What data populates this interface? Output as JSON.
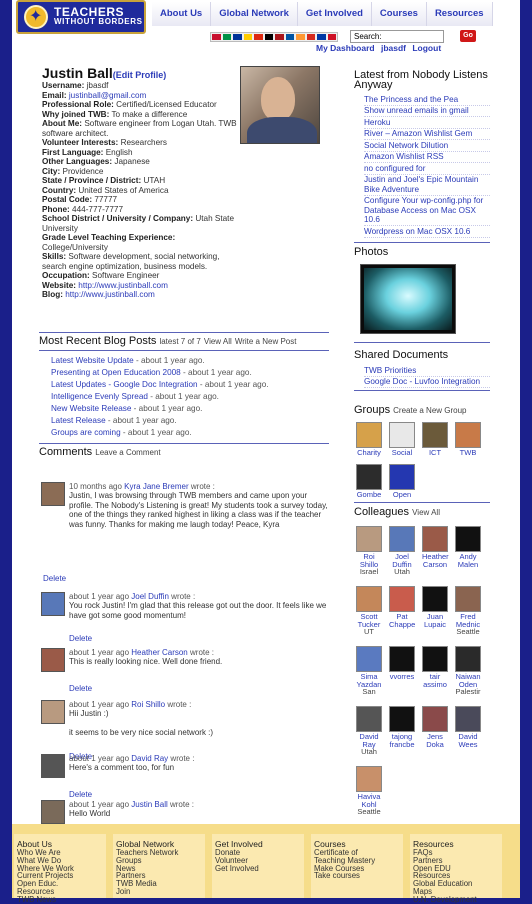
{
  "header": {
    "logo_line1": "TEACHERS",
    "logo_line2": "WITHOUT BORDERS",
    "nav": [
      "About Us",
      "Global Network",
      "Get Involved",
      "Courses",
      "Resources"
    ],
    "search_value": "Search:",
    "go_label": "Go",
    "user_links": [
      "My Dashboard",
      "jbasdf",
      "Logout"
    ],
    "flag_colors": [
      "#c8102e",
      "#009246",
      "#003399",
      "#ffcc00",
      "#de2910",
      "#000000",
      "#aa151b",
      "#0055a4",
      "#ff9933",
      "#d52b1e",
      "#0039a6",
      "#ce1126"
    ]
  },
  "profile": {
    "name": "Justin Ball",
    "edit_label": "(Edit Profile)",
    "fields": [
      {
        "label": "Username:",
        "value": "jbasdf"
      },
      {
        "label": "Email:",
        "value": "justinball@gmail.com",
        "link": true
      },
      {
        "label": "Professional Role:",
        "value": "Certified/Licensed Educator"
      },
      {
        "label": "Why joined TWB:",
        "value": "To make a difference"
      },
      {
        "label": "About Me:",
        "value": "Software engineer from Logan Utah. TWB software architect."
      },
      {
        "label": "Volunteer Interests:",
        "value": "Researchers"
      },
      {
        "label": "First Language:",
        "value": "English"
      },
      {
        "label": "Other Languages:",
        "value": "Japanese"
      },
      {
        "label": "City:",
        "value": "Providence"
      },
      {
        "label": "State / Province / District:",
        "value": "UTAH"
      },
      {
        "label": "Country:",
        "value": "United States of America"
      },
      {
        "label": "Postal Code:",
        "value": "77777"
      },
      {
        "label": "Phone:",
        "value": "444-777-7777"
      },
      {
        "label": "School District / University / Company:",
        "value": "Utah State University"
      },
      {
        "label": "Grade Level Teaching Experience:",
        "value": "College/University"
      },
      {
        "label": "Skills:",
        "value": "Software development, social networking, search engine optimization, business models."
      },
      {
        "label": "Occupation:",
        "value": "Software Engineer"
      },
      {
        "label": "Website:",
        "value": "http://www.justinball.com",
        "link": true
      },
      {
        "label": "Blog:",
        "value": "http://www.justinball.com",
        "link": true
      }
    ]
  },
  "blog": {
    "title": "Most Recent Blog Posts",
    "count_text": "latest 7 of 7",
    "view_all": "View All",
    "write_new": "Write a New Post",
    "posts": [
      {
        "title": "Latest Website Update",
        "age": " - about 1 year ago."
      },
      {
        "title": "Presenting at Open Education 2008",
        "age": " - about 1 year ago."
      },
      {
        "title": "Latest Updates - Google Doc Integration",
        "age": " - about 1 year ago."
      },
      {
        "title": "Intelligence Evenly Spread",
        "age": " - about 1 year ago."
      },
      {
        "title": "New Website Release",
        "age": " - about 1 year ago."
      },
      {
        "title": "Latest Release",
        "age": " - about 1 year ago."
      },
      {
        "title": "Groups are coming",
        "age": " - about 1 year ago."
      }
    ]
  },
  "comments": {
    "title": "Comments",
    "leave": "Leave a Comment",
    "delete_label": "Delete",
    "items": [
      {
        "age": "10 months ago",
        "author": "Kyra Jane Bremer",
        "wrote": "wrote :",
        "text": "Justin, I was browsing through TWB members and came upon your profile. The Nobody's Listening is great! My students took a survey today, one of the things they ranked highest in liking a class was if the teacher was funny. Thanks for making me laugh today! Peace, Kyra",
        "color": "#8b6c55"
      },
      {
        "age": "about 1 year ago",
        "author": "Joel Duffin",
        "wrote": "wrote :",
        "text": "You rock Justin! I'm glad that this release got out the door. It feels like we have got some good momentum!",
        "color": "#5878b8"
      },
      {
        "age": "about 1 year ago",
        "author": "Heather Carson",
        "wrote": "wrote :",
        "text": "This is really looking nice. Well done friend.",
        "color": "#9a5a48"
      },
      {
        "age": "about 1 year ago",
        "author": "Roi Shillo",
        "wrote": "wrote :",
        "text": "Hii Justin :)\n\nit seems to be very nice social network :)",
        "color": "#b89a80"
      },
      {
        "age": "about 1 year ago",
        "author": "David Ray",
        "wrote": "wrote :",
        "text": "Here's a comment too, for fun",
        "color": "#555555"
      },
      {
        "age": "about 1 year ago",
        "author": "Justin Ball",
        "wrote": "wrote :",
        "text": "Hello World",
        "color": "#7a6a5a"
      }
    ]
  },
  "right": {
    "latest_title": "Latest from Nobody Listens Anyway",
    "latest": [
      "The Princess and the Pea",
      "Show unread emails in gmail",
      "Heroku",
      "River – Amazon Wishlist Gem",
      "Social Network Dilution",
      "Amazon Wishlist RSS",
      "no configured for",
      "Justin and Joel's Epic Mountain Bike Adventure",
      "Configure Your wp-config.php for Database Access on Mac OSX 10.6",
      "Wordpress on Mac OSX 10.6"
    ],
    "photos_title": "Photos",
    "docs_title": "Shared Documents",
    "docs": [
      "TWB Priorities",
      "Google Doc - Luvfoo Integration"
    ],
    "groups_title": "Groups",
    "groups_link": "Create a New Group",
    "groups": [
      {
        "name": "Charity",
        "color": "#d6a14a"
      },
      {
        "name": "Social",
        "color": "#e8e8e8"
      },
      {
        "name": "ICT",
        "color": "#6b5a3a"
      },
      {
        "name": "TWB",
        "color": "#c87a48"
      },
      {
        "name": "Gombe",
        "color": "#2c2c2c"
      },
      {
        "name": "Open",
        "color": "#2437b0"
      }
    ],
    "colleagues_title": "Colleagues",
    "colleagues_link": "View All",
    "colleagues": [
      {
        "name": "Roi Shillo",
        "place": "Israel",
        "color": "#b89a80"
      },
      {
        "name": "Joel Duffin",
        "place": "Utah",
        "color": "#5878b8"
      },
      {
        "name": "Heather Carson",
        "place": "",
        "color": "#9a5a48"
      },
      {
        "name": "Andy Malen",
        "place": "",
        "color": "#111111"
      },
      {
        "name": "Scott Tucker",
        "place": "UT",
        "color": "#c4875a"
      },
      {
        "name": "Pat Chappe",
        "place": "",
        "color": "#c95c4c"
      },
      {
        "name": "Juan Lupaic",
        "place": "",
        "color": "#111111"
      },
      {
        "name": "Fred Mednic",
        "place": "Seattle",
        "color": "#8a6450"
      },
      {
        "name": "Sima Yazdan",
        "place": "San",
        "color": "#5a7ac0"
      },
      {
        "name": "vvorres",
        "place": "",
        "color": "#111111"
      },
      {
        "name": "tair assimo",
        "place": "",
        "color": "#111111"
      },
      {
        "name": "Naiwan Oden",
        "place": "Palestir",
        "color": "#2a2a2a"
      },
      {
        "name": "David Ray",
        "place": "Utah",
        "color": "#555555"
      },
      {
        "name": "tajong francbe",
        "place": "",
        "color": "#111111"
      },
      {
        "name": "Jens Doka",
        "place": "",
        "color": "#8a4a4a"
      },
      {
        "name": "David Wees",
        "place": "",
        "color": "#4a4a5a"
      },
      {
        "name": "Haviva Kohl",
        "place": "Seattle",
        "color": "#c8906a"
      }
    ]
  },
  "footer": {
    "columns": [
      {
        "head": "About Us",
        "items": [
          "Who We Are",
          "What We Do",
          "Where We Work",
          "Current Projects",
          "Open Educ.",
          "Resources",
          "TWB News"
        ]
      },
      {
        "head": "Global Network",
        "items": [
          "Teachers Network",
          "Groups",
          "News",
          "Partners",
          "TWB Media",
          "Join"
        ]
      },
      {
        "head": "Get Involved",
        "items": [
          "Donate",
          "Volunteer",
          "Get Involved"
        ]
      },
      {
        "head": "Courses",
        "items": [
          "Certificate of",
          "Teaching Mastery",
          "Make Courses",
          "Take courses"
        ]
      },
      {
        "head": "Resources",
        "items": [
          "FAQs",
          "Partners",
          "Open EDU",
          "Resources",
          "Global Education",
          "Maps",
          "U.N. Development"
        ]
      }
    ]
  }
}
